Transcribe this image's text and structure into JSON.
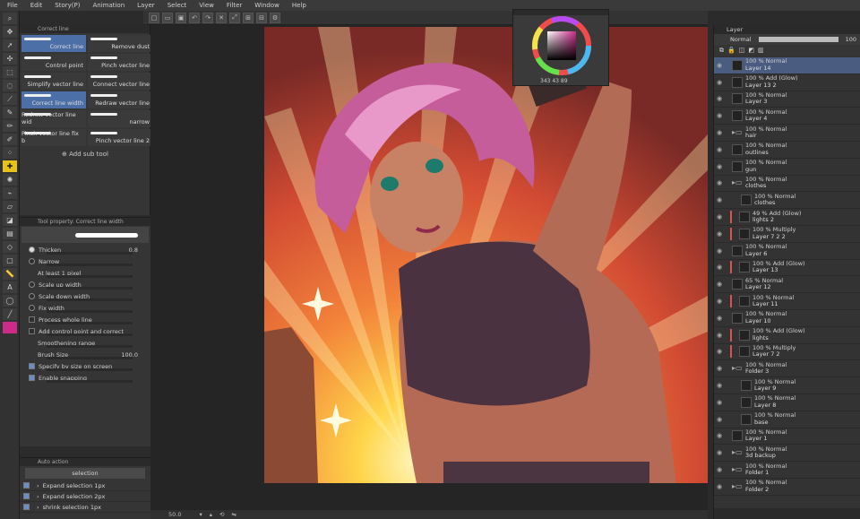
{
  "menu": [
    "File",
    "Edit",
    "Story(P)",
    "Animation",
    "Layer",
    "Select",
    "View",
    "Filter",
    "Window",
    "Help"
  ],
  "subtool": {
    "tabs": [
      "Correct line"
    ],
    "items": [
      {
        "label": "Correct line",
        "selected": true
      },
      {
        "label": "Remove dust",
        "selected": false
      },
      {
        "label": "Control point",
        "selected": false
      },
      {
        "label": "Pinch vector line",
        "selected": false
      },
      {
        "label": "Simplify vector line",
        "selected": false
      },
      {
        "label": "Connect vector line",
        "selected": false
      },
      {
        "label": "Correct line width",
        "selected": true
      },
      {
        "label": "Redraw vector line",
        "selected": false
      },
      {
        "label": "Redraw vector line wid",
        "selected": false
      },
      {
        "label": "narrow",
        "selected": false
      },
      {
        "label": "Pinch vector line fix b",
        "selected": false
      },
      {
        "label": "Pinch vector line 2",
        "selected": false
      }
    ],
    "add_label": "Add sub tool"
  },
  "toolprop": {
    "title": "Correct line width",
    "rows": [
      {
        "type": "radio",
        "on": true,
        "label": "Thicken",
        "value": "0.8"
      },
      {
        "type": "radio",
        "on": false,
        "label": "Narrow"
      },
      {
        "type": "text",
        "label": "At least 1 pixel"
      },
      {
        "type": "radio",
        "on": false,
        "label": "Scale up width"
      },
      {
        "type": "radio",
        "on": false,
        "label": "Scale down width"
      },
      {
        "type": "radio",
        "on": false,
        "label": "Fix width"
      },
      {
        "type": "check",
        "on": false,
        "label": "Process whole line"
      },
      {
        "type": "check",
        "on": false,
        "label": "Add control point and correct"
      },
      {
        "type": "text",
        "label": "Smoothening range"
      },
      {
        "type": "text",
        "label": "Brush Size",
        "value": "100.0"
      },
      {
        "type": "check",
        "on": true,
        "label": "Specify by size on screen"
      },
      {
        "type": "check",
        "on": true,
        "label": "Enable snapping"
      }
    ]
  },
  "autoaction": {
    "dropdown": "selection",
    "items": [
      "Expand selection 1px",
      "Expand selection 2px",
      "shrink selection 1px"
    ]
  },
  "colorwheel": {
    "readout": "343 43 89",
    "hue_color": "#cc2b8a"
  },
  "status": {
    "zoom": "50.0"
  },
  "layers": {
    "tab": "Layer",
    "blend": "Normal",
    "opacity": "100",
    "rows": [
      {
        "blend": "100 % Normal",
        "name": "Layer 14",
        "selected": true
      },
      {
        "blend": "100 % Add (Glow)",
        "name": "Layer 13 2"
      },
      {
        "blend": "100 % Normal",
        "name": "Layer 3"
      },
      {
        "blend": "100 % Normal",
        "name": "Layer 4"
      },
      {
        "blend": "100 % Normal",
        "name": "hair",
        "folder": true
      },
      {
        "blend": "100 % Normal",
        "name": "outlines"
      },
      {
        "blend": "100 % Normal",
        "name": "gun"
      },
      {
        "blend": "100 % Normal",
        "name": "clothes",
        "folder": true
      },
      {
        "blend": "100 % Normal",
        "name": "clothes",
        "indent": true
      },
      {
        "blend": "49 % Add (Glow)",
        "name": "lights 2",
        "clip": true
      },
      {
        "blend": "100 % Multiply",
        "name": "Layer 7 2 2",
        "clip": true
      },
      {
        "blend": "100 % Normal",
        "name": "Layer 6"
      },
      {
        "blend": "100 % Add (Glow)",
        "name": "Layer 13",
        "clip": true
      },
      {
        "blend": "65 % Normal",
        "name": "Layer 12"
      },
      {
        "blend": "100 % Normal",
        "name": "Layer 11",
        "clip": true
      },
      {
        "blend": "100 % Normal",
        "name": "Layer 10"
      },
      {
        "blend": "100 % Add (Glow)",
        "name": "lights",
        "clip": true
      },
      {
        "blend": "100 % Multiply",
        "name": "Layer 7 2",
        "clip": true
      },
      {
        "blend": "100 % Normal",
        "name": "Folder 3",
        "folder": true
      },
      {
        "blend": "100 % Normal",
        "name": "Layer 9",
        "indent": true
      },
      {
        "blend": "100 % Normal",
        "name": "Layer 8",
        "indent": true
      },
      {
        "blend": "100 % Normal",
        "name": "base",
        "indent": true
      },
      {
        "blend": "100 % Normal",
        "name": "Layer 1"
      },
      {
        "blend": "100 % Normal",
        "name": "3d backup",
        "folder": true
      },
      {
        "blend": "100 % Normal",
        "name": "Folder 1",
        "folder": true
      },
      {
        "blend": "100 % Normal",
        "name": "Folder 2",
        "folder": true
      }
    ]
  }
}
